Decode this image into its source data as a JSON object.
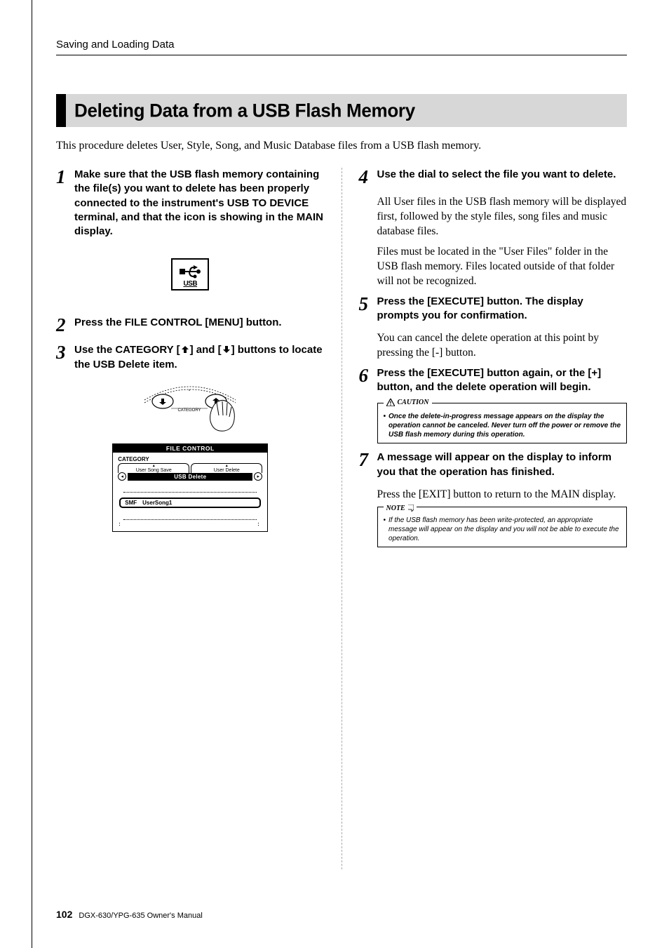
{
  "running_head": "Saving and Loading Data",
  "section_title": "Deleting Data from a USB Flash Memory",
  "intro": "This procedure deletes User, Style, Song, and Music Database files from a USB flash memory.",
  "steps": {
    "s1": {
      "num": "1",
      "head": "Make sure that the USB flash memory containing the file(s) you want to delete has been properly connected to the instrument's USB TO DEVICE terminal, and that the icon is showing in the MAIN display."
    },
    "s2": {
      "num": "2",
      "head": "Press the FILE CONTROL [MENU] button."
    },
    "s3": {
      "num": "3",
      "head_pre": "Use the CATEGORY [",
      "head_mid": "] and [",
      "head_post": "] buttons to locate the USB Delete item."
    },
    "s4": {
      "num": "4",
      "head": "Use the dial to select the file you want to delete.",
      "body1": "All User files in the USB flash memory will be displayed first, followed by the style files, song files and music database files.",
      "body2": "Files must be located in the \"User Files\" folder in the USB flash memory. Files located outside of that folder will not be recognized."
    },
    "s5": {
      "num": "5",
      "head": "Press the [EXECUTE] button. The display prompts you for confirmation.",
      "body": "You can cancel the delete operation at this point by pressing the [-] button."
    },
    "s6": {
      "num": "6",
      "head": "Press the [EXECUTE] button again, or the [+] button, and the delete operation will begin."
    },
    "s7": {
      "num": "7",
      "head": "A message will appear on the display to inform you that the operation has finished.",
      "body": "Press the [EXIT] button to return to the MAIN display."
    }
  },
  "usb_icon_label": "USB",
  "screen": {
    "title": "FILE CONTROL",
    "category_label": "CATEGORY",
    "tab_left": "User Song Save",
    "tab_right": "User Delete",
    "current": "USB Delete",
    "file": "SMF UserSong1"
  },
  "caution": {
    "label": "CAUTION",
    "text": "Once the delete-in-progress message appears on the display the operation cannot be canceled. Never turn off the power or remove the USB flash memory during this operation."
  },
  "note": {
    "label": "NOTE",
    "text": "If the USB flash memory has been write-protected, an appropriate message will appear on the display and you will not be able to execute the operation."
  },
  "footer": {
    "page": "102",
    "doc": "DGX-630/YPG-635  Owner's Manual"
  },
  "dial_label": "CATEGORY"
}
